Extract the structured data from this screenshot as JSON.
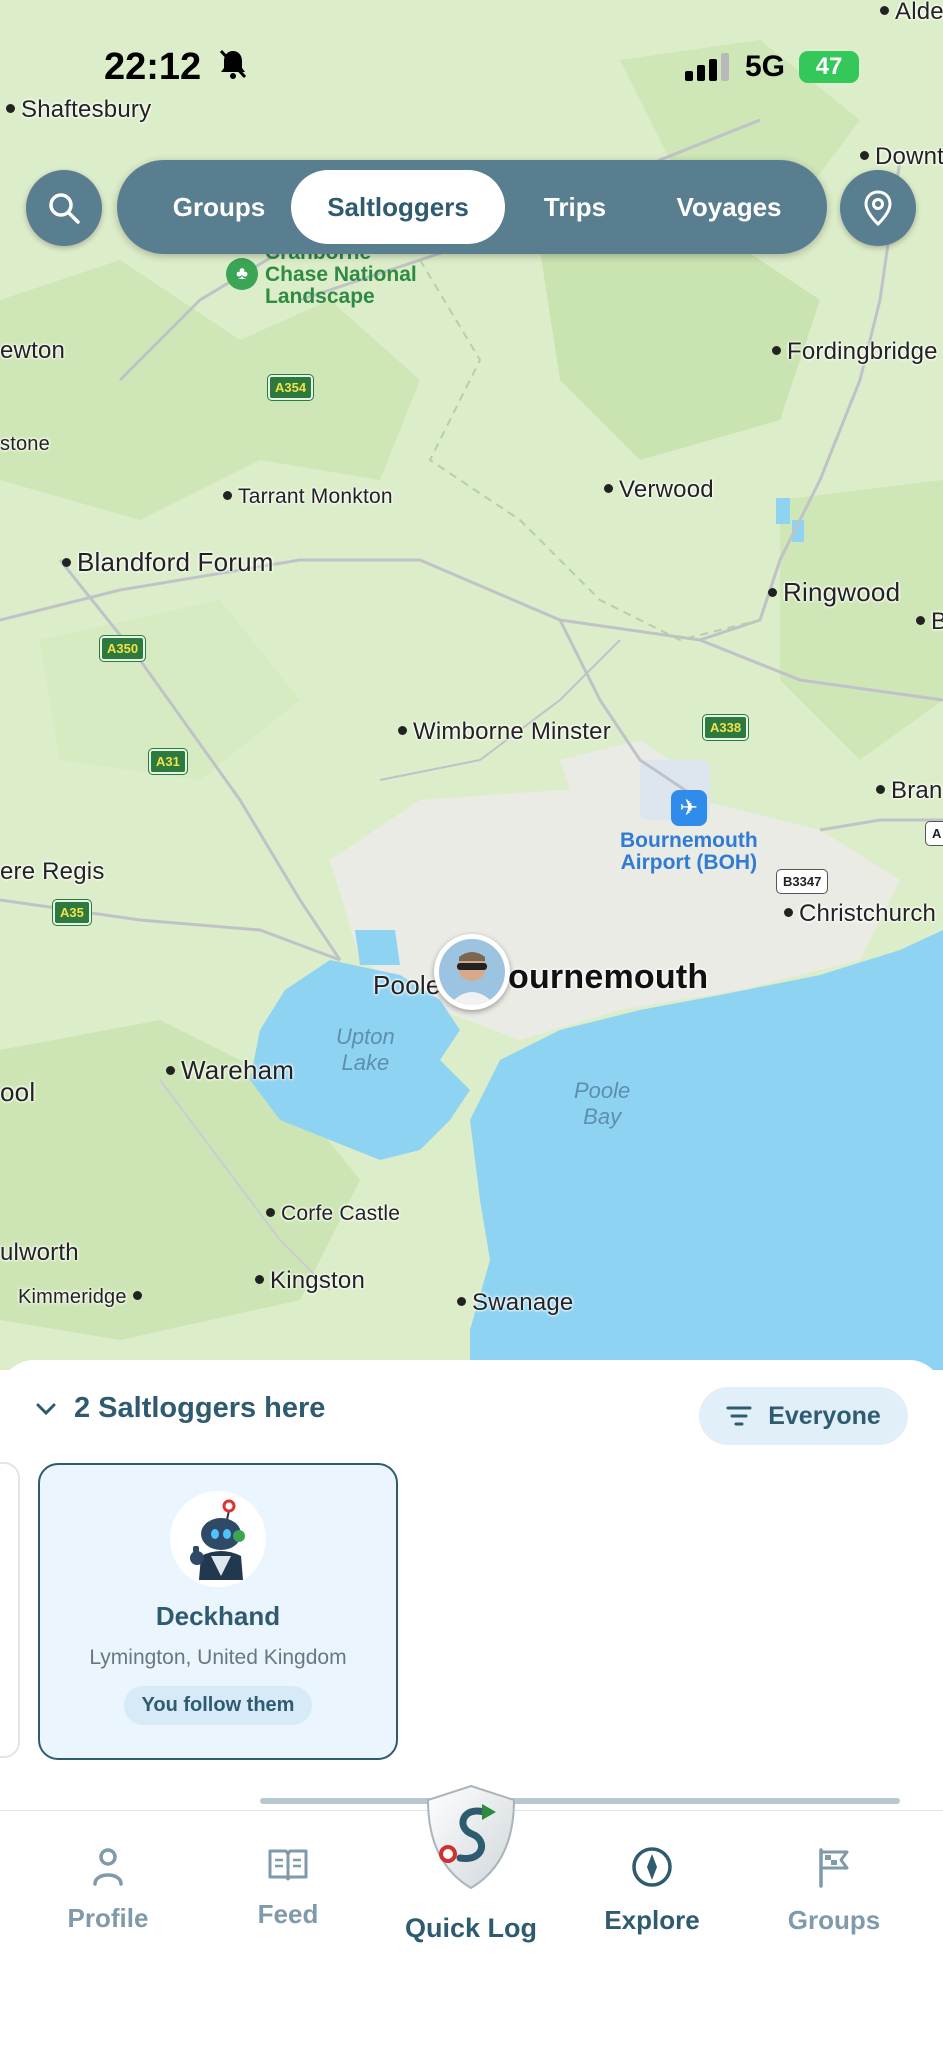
{
  "status_bar": {
    "time": "22:12",
    "carrier": "5G",
    "battery": "47"
  },
  "top_nav": {
    "tabs": [
      {
        "label": "Groups",
        "active": false
      },
      {
        "label": "Saltloggers",
        "active": true
      },
      {
        "label": "Trips",
        "active": false
      },
      {
        "label": "Voyages",
        "active": false
      }
    ],
    "search_icon": "search-icon",
    "location_icon": "location-pin-icon"
  },
  "map": {
    "places": {
      "alderholt": "Alde",
      "shaftesbury": "Shaftesbury",
      "downton": "Downt",
      "newton": "ewton",
      "fordingbridge": "Fordingbridge",
      "stone": "stone",
      "tarrant_monkton": "Tarrant Monkton",
      "verwood": "Verwood",
      "blandford_forum": "Blandford Forum",
      "ringwood": "Ringwood",
      "bu": "Bu",
      "wimborne_minster": "Wimborne Minster",
      "bransgore": "Bran",
      "bere_regis": "ere Regis",
      "christchurch": "Christchurch",
      "poole": "Poole",
      "bournemouth": "ournemouth",
      "wareham": "Wareham",
      "ool": "ool",
      "corfe_castle": "Corfe Castle",
      "lulworth": "ulworth",
      "kingston": "Kingston",
      "kimmeridge": "Kimmeridge",
      "swanage": "Swanage"
    },
    "park": {
      "line1": "Cranborne",
      "line2": "Chase National",
      "line3": "Landscape"
    },
    "water": {
      "upton_lake_1": "Upton",
      "upton_lake_2": "Lake",
      "poole_bay_1": "Poole",
      "poole_bay_2": "Bay"
    },
    "airport": {
      "line1": "Bournemouth",
      "line2": "Airport (BOH)"
    },
    "roads": {
      "a354": "A354",
      "a350": "A350",
      "a338": "A338",
      "a31": "A31",
      "a35": "A35",
      "b3347": "B3347",
      "a_edge": "A"
    }
  },
  "sheet": {
    "title": "2 Saltloggers here",
    "filter_label": "Everyone",
    "card": {
      "name": "Deckhand",
      "location": "Lymington, United Kingdom",
      "follow_status": "You follow them"
    }
  },
  "tab_bar": {
    "profile": "Profile",
    "feed": "Feed",
    "quick_log": "Quick Log",
    "explore": "Explore",
    "groups": "Groups",
    "active": "explore"
  },
  "colors": {
    "brand": "#2f5b70",
    "nav_bg": "#587e8f",
    "land": "#dfeecf",
    "water": "#8fd3f2",
    "pill_bg": "#e1eff9"
  }
}
